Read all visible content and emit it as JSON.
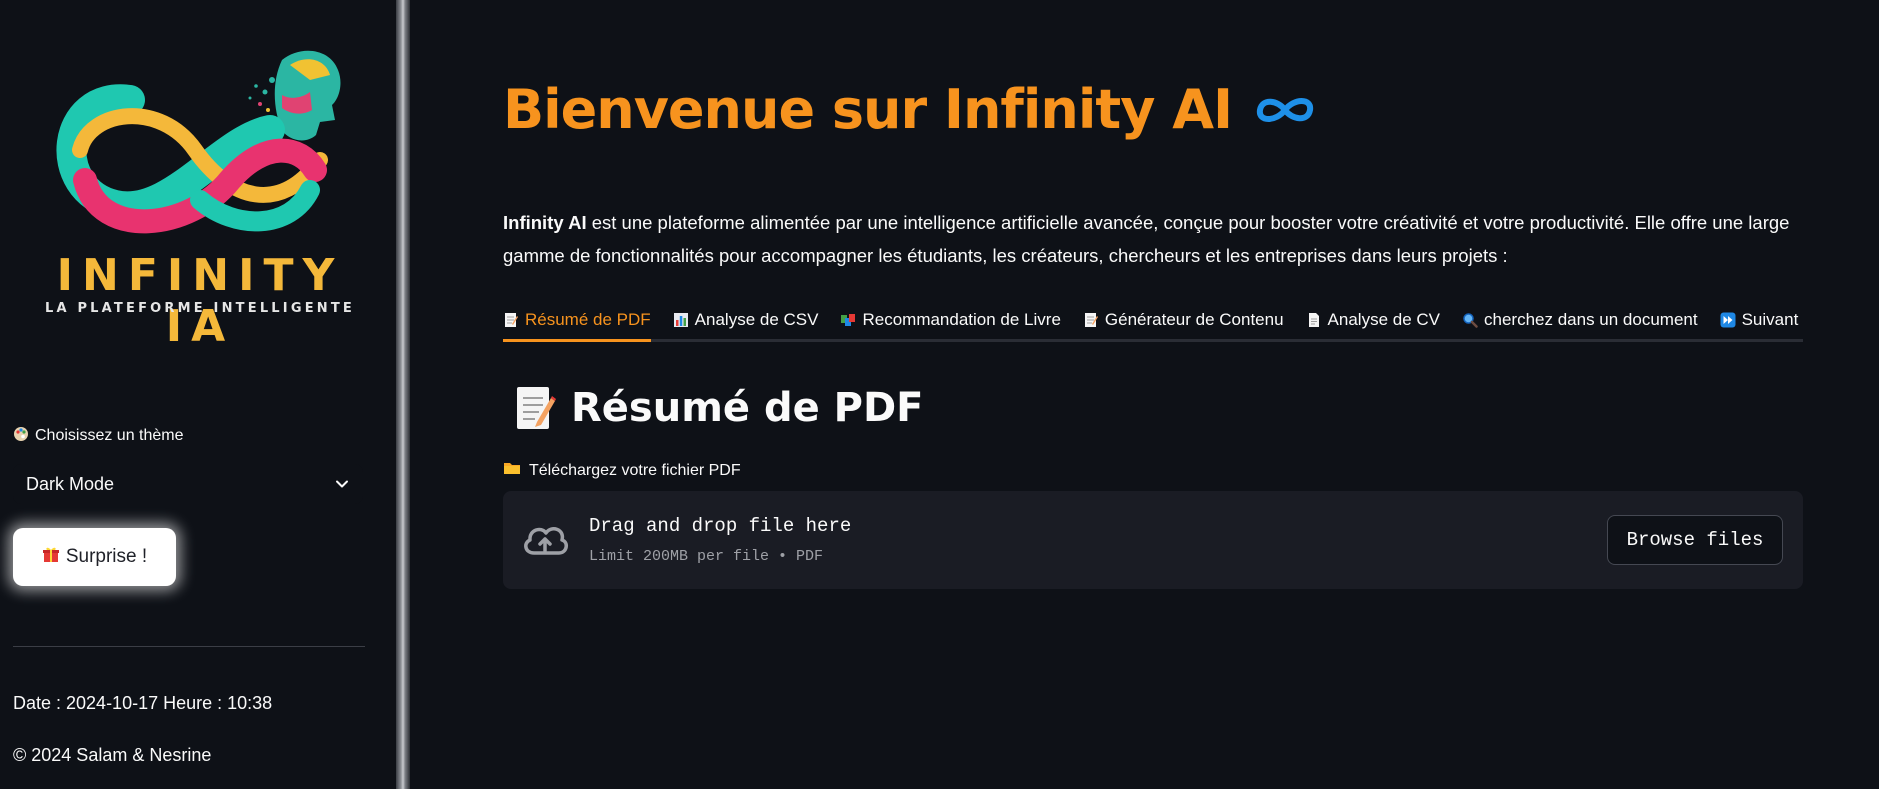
{
  "sidebar": {
    "logo": {
      "title": "INFINITY IA",
      "subtitle": "LA PLATEFORME INTELLIGENTE"
    },
    "theme_label": "Choisissez un thème",
    "theme_icon": "palette-icon",
    "theme_value": "Dark Mode",
    "surprise_button": "Surprise !",
    "surprise_icon": "gift-icon",
    "datetime": "Date : 2024-10-17 Heure : 10:38",
    "copyright": "© 2024 Salam & Nesrine"
  },
  "main": {
    "title": "Bienvenue sur Infinity AI",
    "title_icon": "infinity-icon",
    "intro_bold": "Infinity AI",
    "intro_rest": " est une plateforme alimentée par une intelligence artificielle avancée, conçue pour booster votre créativité et votre productivité. Elle offre une large gamme de fonctionnalités pour accompagner les étudiants, les créateurs, chercheurs et les entreprises dans leurs projets :",
    "tabs": [
      {
        "label": "Résumé de PDF",
        "icon": "memo-icon",
        "active": true
      },
      {
        "label": "Analyse de CSV",
        "icon": "bar-chart-icon",
        "active": false
      },
      {
        "label": "Recommandation de Livre",
        "icon": "books-icon",
        "active": false
      },
      {
        "label": "Générateur de Contenu",
        "icon": "memo-icon",
        "active": false
      },
      {
        "label": "Analyse de CV",
        "icon": "page-icon",
        "active": false
      },
      {
        "label": "cherchez dans un document",
        "icon": "magnifier-icon",
        "active": false
      },
      {
        "label": "Suivant",
        "icon": "fast-forward-icon",
        "active": false
      }
    ],
    "section_title": "Résumé de PDF",
    "upload_label": "Téléchargez votre fichier PDF",
    "upload_icon": "folder-icon",
    "dropzone": {
      "main_text": "Drag and drop file here",
      "sub_text": "Limit 200MB per file • PDF",
      "browse_button": "Browse files"
    }
  },
  "colors": {
    "background": "#0e1117",
    "accent": "#f7931e",
    "dropzone_bg": "#1a1c24",
    "infinity_icon": "#1e90e8"
  }
}
